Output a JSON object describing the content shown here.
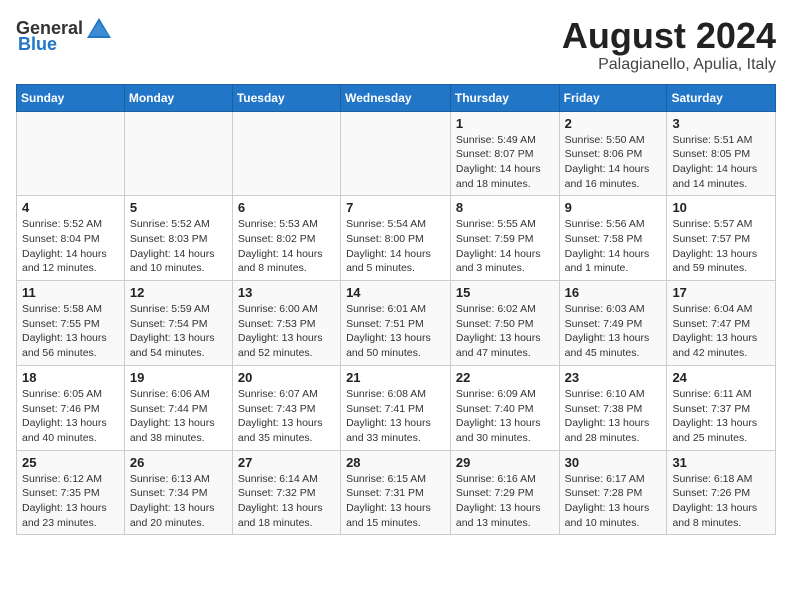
{
  "logo": {
    "general": "General",
    "blue": "Blue"
  },
  "title": "August 2024",
  "subtitle": "Palagianello, Apulia, Italy",
  "days_of_week": [
    "Sunday",
    "Monday",
    "Tuesday",
    "Wednesday",
    "Thursday",
    "Friday",
    "Saturday"
  ],
  "weeks": [
    [
      {
        "day": "",
        "info": ""
      },
      {
        "day": "",
        "info": ""
      },
      {
        "day": "",
        "info": ""
      },
      {
        "day": "",
        "info": ""
      },
      {
        "day": "1",
        "info": "Sunrise: 5:49 AM\nSunset: 8:07 PM\nDaylight: 14 hours\nand 18 minutes."
      },
      {
        "day": "2",
        "info": "Sunrise: 5:50 AM\nSunset: 8:06 PM\nDaylight: 14 hours\nand 16 minutes."
      },
      {
        "day": "3",
        "info": "Sunrise: 5:51 AM\nSunset: 8:05 PM\nDaylight: 14 hours\nand 14 minutes."
      }
    ],
    [
      {
        "day": "4",
        "info": "Sunrise: 5:52 AM\nSunset: 8:04 PM\nDaylight: 14 hours\nand 12 minutes."
      },
      {
        "day": "5",
        "info": "Sunrise: 5:52 AM\nSunset: 8:03 PM\nDaylight: 14 hours\nand 10 minutes."
      },
      {
        "day": "6",
        "info": "Sunrise: 5:53 AM\nSunset: 8:02 PM\nDaylight: 14 hours\nand 8 minutes."
      },
      {
        "day": "7",
        "info": "Sunrise: 5:54 AM\nSunset: 8:00 PM\nDaylight: 14 hours\nand 5 minutes."
      },
      {
        "day": "8",
        "info": "Sunrise: 5:55 AM\nSunset: 7:59 PM\nDaylight: 14 hours\nand 3 minutes."
      },
      {
        "day": "9",
        "info": "Sunrise: 5:56 AM\nSunset: 7:58 PM\nDaylight: 14 hours\nand 1 minute."
      },
      {
        "day": "10",
        "info": "Sunrise: 5:57 AM\nSunset: 7:57 PM\nDaylight: 13 hours\nand 59 minutes."
      }
    ],
    [
      {
        "day": "11",
        "info": "Sunrise: 5:58 AM\nSunset: 7:55 PM\nDaylight: 13 hours\nand 56 minutes."
      },
      {
        "day": "12",
        "info": "Sunrise: 5:59 AM\nSunset: 7:54 PM\nDaylight: 13 hours\nand 54 minutes."
      },
      {
        "day": "13",
        "info": "Sunrise: 6:00 AM\nSunset: 7:53 PM\nDaylight: 13 hours\nand 52 minutes."
      },
      {
        "day": "14",
        "info": "Sunrise: 6:01 AM\nSunset: 7:51 PM\nDaylight: 13 hours\nand 50 minutes."
      },
      {
        "day": "15",
        "info": "Sunrise: 6:02 AM\nSunset: 7:50 PM\nDaylight: 13 hours\nand 47 minutes."
      },
      {
        "day": "16",
        "info": "Sunrise: 6:03 AM\nSunset: 7:49 PM\nDaylight: 13 hours\nand 45 minutes."
      },
      {
        "day": "17",
        "info": "Sunrise: 6:04 AM\nSunset: 7:47 PM\nDaylight: 13 hours\nand 42 minutes."
      }
    ],
    [
      {
        "day": "18",
        "info": "Sunrise: 6:05 AM\nSunset: 7:46 PM\nDaylight: 13 hours\nand 40 minutes."
      },
      {
        "day": "19",
        "info": "Sunrise: 6:06 AM\nSunset: 7:44 PM\nDaylight: 13 hours\nand 38 minutes."
      },
      {
        "day": "20",
        "info": "Sunrise: 6:07 AM\nSunset: 7:43 PM\nDaylight: 13 hours\nand 35 minutes."
      },
      {
        "day": "21",
        "info": "Sunrise: 6:08 AM\nSunset: 7:41 PM\nDaylight: 13 hours\nand 33 minutes."
      },
      {
        "day": "22",
        "info": "Sunrise: 6:09 AM\nSunset: 7:40 PM\nDaylight: 13 hours\nand 30 minutes."
      },
      {
        "day": "23",
        "info": "Sunrise: 6:10 AM\nSunset: 7:38 PM\nDaylight: 13 hours\nand 28 minutes."
      },
      {
        "day": "24",
        "info": "Sunrise: 6:11 AM\nSunset: 7:37 PM\nDaylight: 13 hours\nand 25 minutes."
      }
    ],
    [
      {
        "day": "25",
        "info": "Sunrise: 6:12 AM\nSunset: 7:35 PM\nDaylight: 13 hours\nand 23 minutes."
      },
      {
        "day": "26",
        "info": "Sunrise: 6:13 AM\nSunset: 7:34 PM\nDaylight: 13 hours\nand 20 minutes."
      },
      {
        "day": "27",
        "info": "Sunrise: 6:14 AM\nSunset: 7:32 PM\nDaylight: 13 hours\nand 18 minutes."
      },
      {
        "day": "28",
        "info": "Sunrise: 6:15 AM\nSunset: 7:31 PM\nDaylight: 13 hours\nand 15 minutes."
      },
      {
        "day": "29",
        "info": "Sunrise: 6:16 AM\nSunset: 7:29 PM\nDaylight: 13 hours\nand 13 minutes."
      },
      {
        "day": "30",
        "info": "Sunrise: 6:17 AM\nSunset: 7:28 PM\nDaylight: 13 hours\nand 10 minutes."
      },
      {
        "day": "31",
        "info": "Sunrise: 6:18 AM\nSunset: 7:26 PM\nDaylight: 13 hours\nand 8 minutes."
      }
    ]
  ]
}
